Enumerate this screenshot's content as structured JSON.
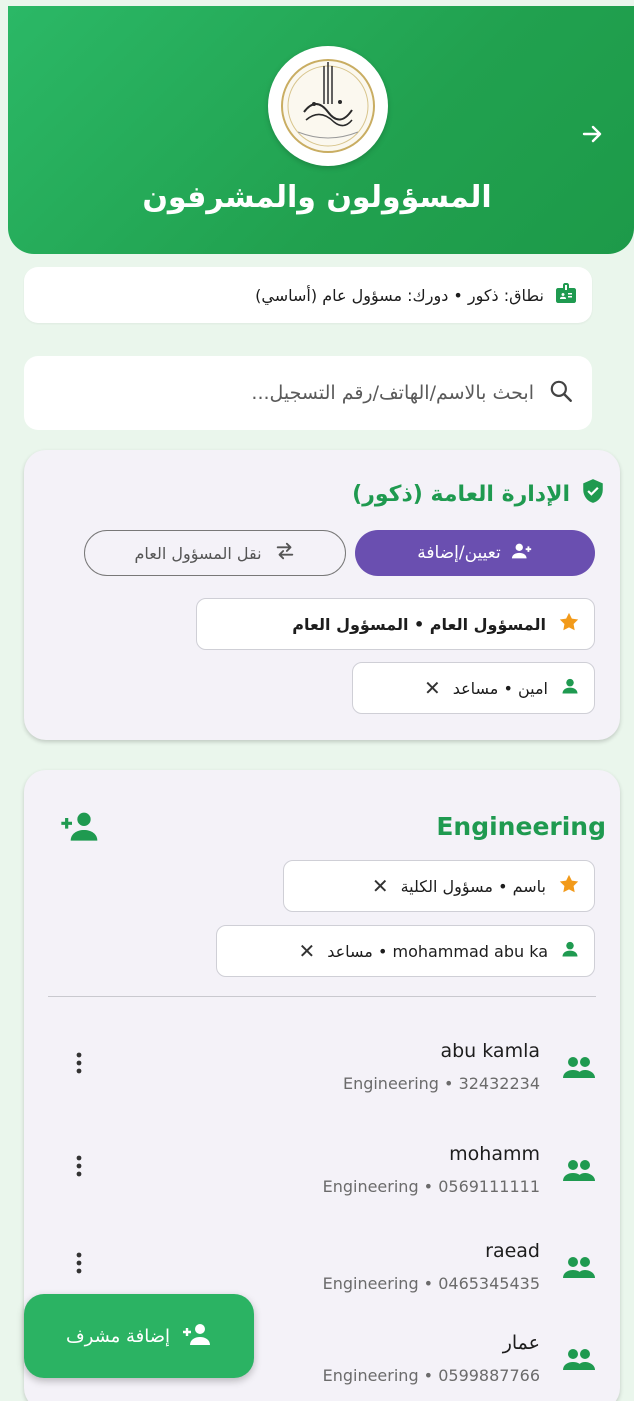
{
  "header": {
    "title": "المسؤولون والمشرفون",
    "back_icon": "arrow-forward-icon",
    "logo_icon": "university-emblem-icon"
  },
  "scope": {
    "text": "نطاق: ذكور • دورك: مسؤول عام (أساسي)",
    "icon": "badge-icon"
  },
  "search": {
    "placeholder": "ابحث بالاسم/الهاتف/رقم التسجيل..."
  },
  "general_admin": {
    "title": "الإدارة العامة (ذكور)",
    "assign_label": "تعيين/إضافة",
    "transfer_label": "نقل المسؤول العام",
    "chips": [
      {
        "text": "المسؤول العام • المسؤول العام",
        "icon": "star-icon"
      },
      {
        "text": "امين • مساعد",
        "icon": "person-icon"
      }
    ]
  },
  "faculty": {
    "title": "Engineering",
    "chips": [
      {
        "text": "باسم • مسؤول الكلية",
        "icon": "star-icon"
      },
      {
        "text": "mohammad abu ka • مساعد",
        "icon": "person-icon"
      }
    ],
    "members": [
      {
        "name": "abu kamla",
        "sub": "Engineering • 32432234"
      },
      {
        "name": "mohamm",
        "sub": "Engineering • 0569111111"
      },
      {
        "name": "raead",
        "sub": "Engineering • 0465345435"
      },
      {
        "name": "عمار",
        "sub": "Engineering • 0599887766"
      }
    ]
  },
  "fab": {
    "label": "إضافة مشرف"
  },
  "colors": {
    "primary_green": "#2bb363",
    "purple": "#6a4fb0",
    "star": "#f29a1a"
  }
}
